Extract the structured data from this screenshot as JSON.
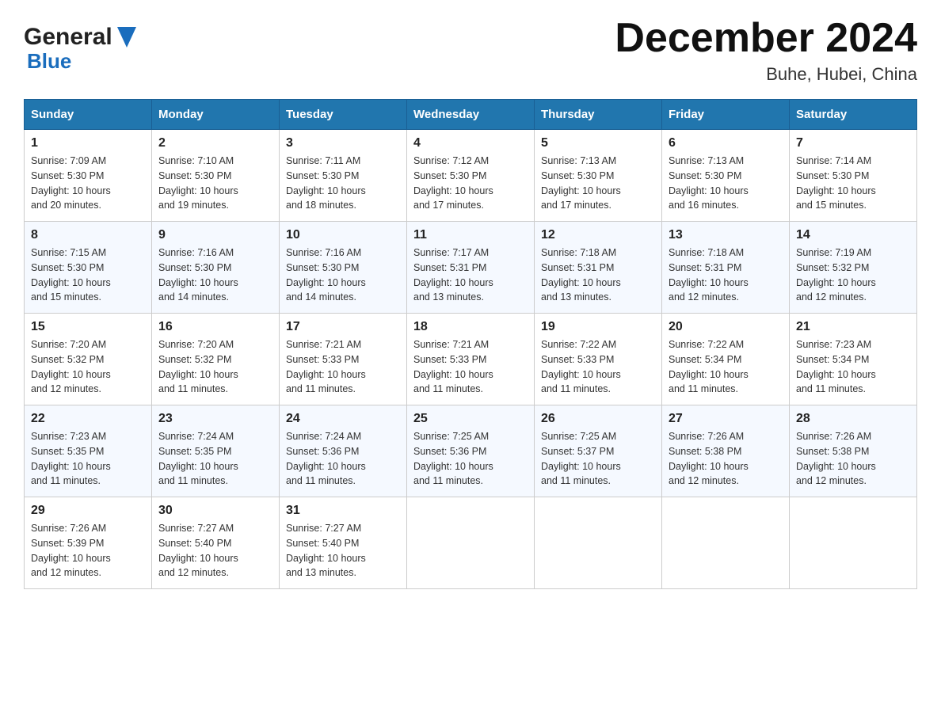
{
  "logo": {
    "general": "General",
    "blue": "Blue",
    "triangle_color": "#1a6dbd"
  },
  "title": "December 2024",
  "subtitle": "Buhe, Hubei, China",
  "days_of_week": [
    "Sunday",
    "Monday",
    "Tuesday",
    "Wednesday",
    "Thursday",
    "Friday",
    "Saturday"
  ],
  "weeks": [
    [
      {
        "day": "1",
        "sunrise": "7:09 AM",
        "sunset": "5:30 PM",
        "daylight": "10 hours and 20 minutes."
      },
      {
        "day": "2",
        "sunrise": "7:10 AM",
        "sunset": "5:30 PM",
        "daylight": "10 hours and 19 minutes."
      },
      {
        "day": "3",
        "sunrise": "7:11 AM",
        "sunset": "5:30 PM",
        "daylight": "10 hours and 18 minutes."
      },
      {
        "day": "4",
        "sunrise": "7:12 AM",
        "sunset": "5:30 PM",
        "daylight": "10 hours and 17 minutes."
      },
      {
        "day": "5",
        "sunrise": "7:13 AM",
        "sunset": "5:30 PM",
        "daylight": "10 hours and 17 minutes."
      },
      {
        "day": "6",
        "sunrise": "7:13 AM",
        "sunset": "5:30 PM",
        "daylight": "10 hours and 16 minutes."
      },
      {
        "day": "7",
        "sunrise": "7:14 AM",
        "sunset": "5:30 PM",
        "daylight": "10 hours and 15 minutes."
      }
    ],
    [
      {
        "day": "8",
        "sunrise": "7:15 AM",
        "sunset": "5:30 PM",
        "daylight": "10 hours and 15 minutes."
      },
      {
        "day": "9",
        "sunrise": "7:16 AM",
        "sunset": "5:30 PM",
        "daylight": "10 hours and 14 minutes."
      },
      {
        "day": "10",
        "sunrise": "7:16 AM",
        "sunset": "5:30 PM",
        "daylight": "10 hours and 14 minutes."
      },
      {
        "day": "11",
        "sunrise": "7:17 AM",
        "sunset": "5:31 PM",
        "daylight": "10 hours and 13 minutes."
      },
      {
        "day": "12",
        "sunrise": "7:18 AM",
        "sunset": "5:31 PM",
        "daylight": "10 hours and 13 minutes."
      },
      {
        "day": "13",
        "sunrise": "7:18 AM",
        "sunset": "5:31 PM",
        "daylight": "10 hours and 12 minutes."
      },
      {
        "day": "14",
        "sunrise": "7:19 AM",
        "sunset": "5:32 PM",
        "daylight": "10 hours and 12 minutes."
      }
    ],
    [
      {
        "day": "15",
        "sunrise": "7:20 AM",
        "sunset": "5:32 PM",
        "daylight": "10 hours and 12 minutes."
      },
      {
        "day": "16",
        "sunrise": "7:20 AM",
        "sunset": "5:32 PM",
        "daylight": "10 hours and 11 minutes."
      },
      {
        "day": "17",
        "sunrise": "7:21 AM",
        "sunset": "5:33 PM",
        "daylight": "10 hours and 11 minutes."
      },
      {
        "day": "18",
        "sunrise": "7:21 AM",
        "sunset": "5:33 PM",
        "daylight": "10 hours and 11 minutes."
      },
      {
        "day": "19",
        "sunrise": "7:22 AM",
        "sunset": "5:33 PM",
        "daylight": "10 hours and 11 minutes."
      },
      {
        "day": "20",
        "sunrise": "7:22 AM",
        "sunset": "5:34 PM",
        "daylight": "10 hours and 11 minutes."
      },
      {
        "day": "21",
        "sunrise": "7:23 AM",
        "sunset": "5:34 PM",
        "daylight": "10 hours and 11 minutes."
      }
    ],
    [
      {
        "day": "22",
        "sunrise": "7:23 AM",
        "sunset": "5:35 PM",
        "daylight": "10 hours and 11 minutes."
      },
      {
        "day": "23",
        "sunrise": "7:24 AM",
        "sunset": "5:35 PM",
        "daylight": "10 hours and 11 minutes."
      },
      {
        "day": "24",
        "sunrise": "7:24 AM",
        "sunset": "5:36 PM",
        "daylight": "10 hours and 11 minutes."
      },
      {
        "day": "25",
        "sunrise": "7:25 AM",
        "sunset": "5:36 PM",
        "daylight": "10 hours and 11 minutes."
      },
      {
        "day": "26",
        "sunrise": "7:25 AM",
        "sunset": "5:37 PM",
        "daylight": "10 hours and 11 minutes."
      },
      {
        "day": "27",
        "sunrise": "7:26 AM",
        "sunset": "5:38 PM",
        "daylight": "10 hours and 12 minutes."
      },
      {
        "day": "28",
        "sunrise": "7:26 AM",
        "sunset": "5:38 PM",
        "daylight": "10 hours and 12 minutes."
      }
    ],
    [
      {
        "day": "29",
        "sunrise": "7:26 AM",
        "sunset": "5:39 PM",
        "daylight": "10 hours and 12 minutes."
      },
      {
        "day": "30",
        "sunrise": "7:27 AM",
        "sunset": "5:40 PM",
        "daylight": "10 hours and 12 minutes."
      },
      {
        "day": "31",
        "sunrise": "7:27 AM",
        "sunset": "5:40 PM",
        "daylight": "10 hours and 13 minutes."
      },
      null,
      null,
      null,
      null
    ]
  ],
  "labels": {
    "sunrise": "Sunrise:",
    "sunset": "Sunset:",
    "daylight": "Daylight:"
  }
}
